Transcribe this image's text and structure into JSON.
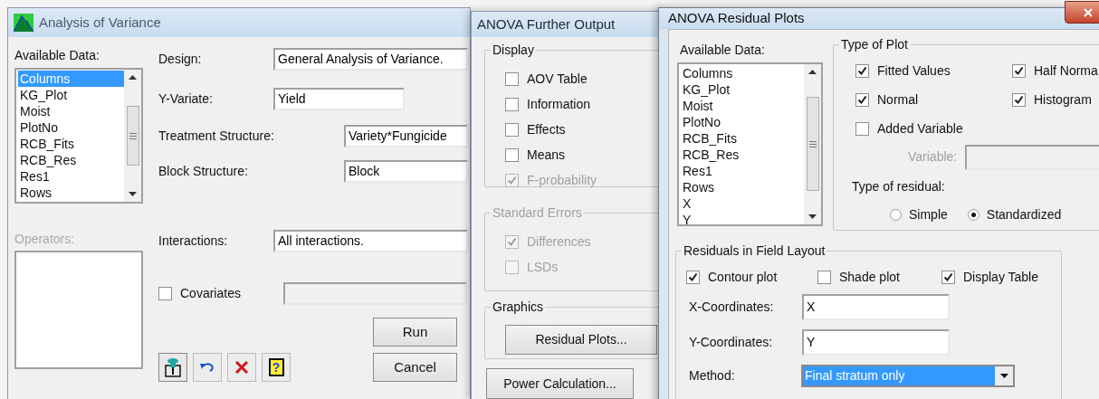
{
  "anova_window": {
    "title": "Analysis of Variance",
    "available_data_label": "Available Data:",
    "data_list": [
      {
        "label": "Columns",
        "selected": true
      },
      {
        "label": "KG_Plot",
        "selected": false
      },
      {
        "label": "Moist",
        "selected": false
      },
      {
        "label": "PlotNo",
        "selected": false
      },
      {
        "label": "RCB_Fits",
        "selected": false
      },
      {
        "label": "RCB_Res",
        "selected": false
      },
      {
        "label": "Res1",
        "selected": false
      },
      {
        "label": "Rows",
        "selected": false
      }
    ],
    "operators_label": "Operators:",
    "fields": [
      {
        "label": "Design:",
        "value": "General Analysis of Variance."
      },
      {
        "label": "Y-Variate:",
        "value": "Yield"
      },
      {
        "label": "Treatment Structure:",
        "value": "Variety*Fungicide"
      },
      {
        "label": "Block Structure:",
        "value": "Block"
      },
      {
        "label": "Interactions:",
        "value": "All interactions."
      }
    ],
    "covariates": {
      "label": "Covariates",
      "checked": false
    },
    "buttons": [
      "Run",
      "Cancel"
    ],
    "help_label": "?"
  },
  "further_output_window": {
    "title": "ANOVA Further Output",
    "groups": [
      {
        "title": "Display",
        "disabled": false,
        "options": [
          {
            "label": "AOV Table",
            "checked": false,
            "disabled": false
          },
          {
            "label": "Information",
            "checked": false,
            "disabled": false
          },
          {
            "label": "Effects",
            "checked": false,
            "disabled": false
          },
          {
            "label": "Means",
            "checked": false,
            "disabled": false
          },
          {
            "label": "F-probability",
            "checked": true,
            "disabled": true
          }
        ]
      },
      {
        "title": "Standard Errors",
        "disabled": true,
        "options": [
          {
            "label": "Differences",
            "checked": true,
            "disabled": true
          },
          {
            "label": "LSDs",
            "checked": false,
            "disabled": true
          }
        ]
      }
    ],
    "graphics": {
      "title": "Graphics",
      "button": "Residual Plots..."
    },
    "power_button": "Power Calculation..."
  },
  "residual_plots_window": {
    "title": "ANOVA Residual Plots",
    "available_data_label": "Available Data:",
    "data_list": [
      {
        "label": "Columns",
        "selected": false
      },
      {
        "label": "KG_Plot",
        "selected": false
      },
      {
        "label": "Moist",
        "selected": false
      },
      {
        "label": "PlotNo",
        "selected": false
      },
      {
        "label": "RCB_Fits",
        "selected": false
      },
      {
        "label": "RCB_Res",
        "selected": false
      },
      {
        "label": "Res1",
        "selected": false
      },
      {
        "label": "Rows",
        "selected": false
      },
      {
        "label": "X",
        "selected": false
      },
      {
        "label": "Y",
        "selected": false
      }
    ],
    "type_of_plot": {
      "title": "Type of Plot",
      "options": [
        {
          "label": "Fitted Values",
          "checked": true
        },
        {
          "label": "Half Norma",
          "checked": true
        },
        {
          "label": "Normal",
          "checked": true
        },
        {
          "label": "Histogram",
          "checked": true
        },
        {
          "label": "Added Variable",
          "checked": false
        }
      ],
      "variable_label": "Variable:",
      "residual_label": "Type of residual:",
      "residual_types": [
        {
          "label": "Simple",
          "selected": false
        },
        {
          "label": "Standardized",
          "selected": true
        }
      ]
    },
    "field_layout": {
      "title": "Residuals in Field Layout",
      "options": [
        {
          "label": "Contour plot",
          "checked": true
        },
        {
          "label": "Shade plot",
          "checked": false
        },
        {
          "label": "Display Table",
          "checked": true
        }
      ],
      "coordinates": [
        {
          "label": "X-Coordinates:",
          "value": "X"
        },
        {
          "label": "Y-Coordinates:",
          "value": "Y"
        }
      ],
      "method": {
        "label": "Method:",
        "value": "Final stratum only"
      }
    }
  }
}
